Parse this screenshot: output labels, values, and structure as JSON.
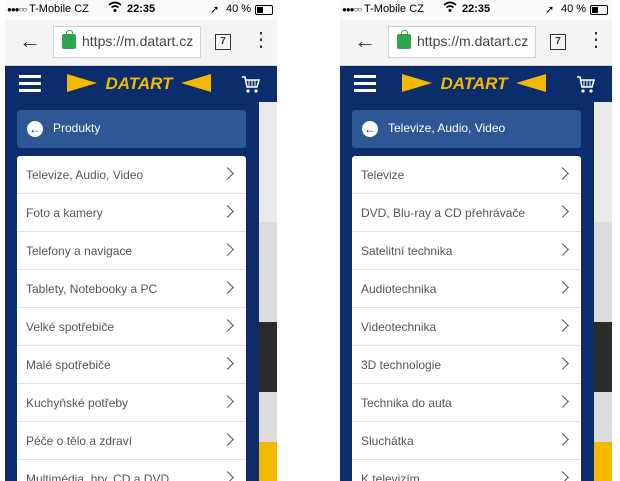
{
  "status_bar": {
    "signal": "●●●○○",
    "carrier": "T-Mobile CZ",
    "time": "22:35",
    "battery": "40 %"
  },
  "browser": {
    "url": "https://m.datart.cz",
    "tab_count": "7"
  },
  "site": {
    "logo_text": "DATART"
  },
  "left_panel": {
    "back_label": "Produkty",
    "items": [
      {
        "label": "Televize, Audio, Video"
      },
      {
        "label": "Foto a kamery"
      },
      {
        "label": "Telefony a navigace"
      },
      {
        "label": "Tablety, Notebooky a PC"
      },
      {
        "label": "Velké spotřebiče"
      },
      {
        "label": "Malé spotřebiče"
      },
      {
        "label": "Kuchyňské potřeby"
      },
      {
        "label": "Péče o tělo a zdraví"
      },
      {
        "label": "Multimédia, hry, CD a DVD"
      }
    ]
  },
  "right_panel": {
    "back_label": "Televize, Audio, Video",
    "items": [
      {
        "label": "Televize"
      },
      {
        "label": "DVD, Blu-ray a CD přehrávače"
      },
      {
        "label": "Satelitní technika"
      },
      {
        "label": "Audiotechnika"
      },
      {
        "label": "Videotechnika"
      },
      {
        "label": "3D technologie"
      },
      {
        "label": "Technika do auta"
      },
      {
        "label": "Sluchátka"
      },
      {
        "label": "K televizím"
      }
    ]
  },
  "colors": {
    "brand_navy": "#0c2d6b",
    "button_blue": "#2e5795",
    "logo_yellow": "#f5b800",
    "lock_green": "#2ea44f"
  },
  "icons": [
    "signal-dots-icon",
    "wifi-icon",
    "location-arrow-icon",
    "battery-icon",
    "back-arrow-icon",
    "lock-icon",
    "tabs-icon",
    "kebab-menu-icon",
    "hamburger-icon",
    "cart-icon",
    "back-circle-icon",
    "chevron-right-icon"
  ]
}
